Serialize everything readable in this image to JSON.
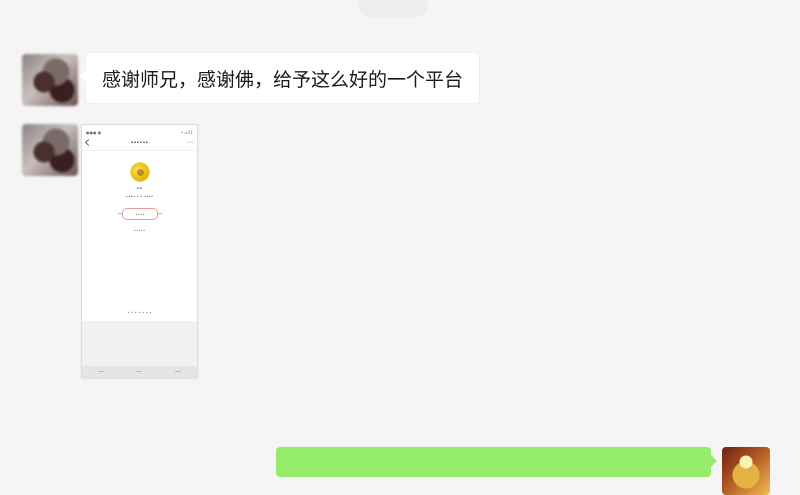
{
  "chat": {
    "message1": "感谢师兄，感谢佛，给予这么好的一个平台"
  },
  "phone": {
    "status_left": "●●● ●",
    "status_right": "• ◂ 21",
    "title": "••••••",
    "logo_name": "••",
    "subtitle": "•••• • • ••••",
    "pill_label": "••••",
    "link_text": "•••••",
    "footer_text": "• • • • • • •"
  },
  "colors": {
    "background": "#f5f5f5",
    "bubble_white": "#ffffff",
    "bubble_green": "#95ec69"
  },
  "icons": {
    "back": "back-icon",
    "more": "more-icon"
  }
}
